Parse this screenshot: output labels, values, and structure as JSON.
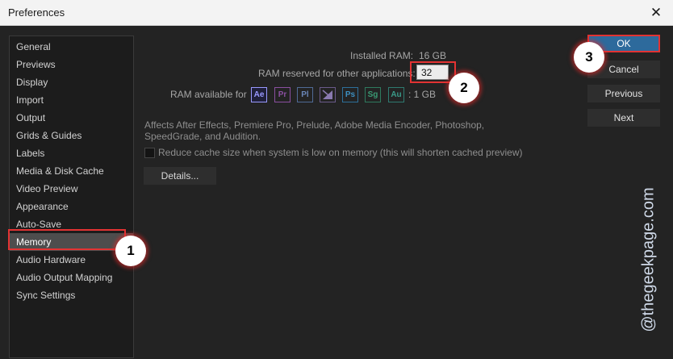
{
  "window": {
    "title": "Preferences",
    "close_glyph": "✕"
  },
  "sidebar": {
    "items": [
      {
        "label": "General"
      },
      {
        "label": "Previews"
      },
      {
        "label": "Display"
      },
      {
        "label": "Import"
      },
      {
        "label": "Output"
      },
      {
        "label": "Grids & Guides"
      },
      {
        "label": "Labels"
      },
      {
        "label": "Media & Disk Cache"
      },
      {
        "label": "Video Preview"
      },
      {
        "label": "Appearance"
      },
      {
        "label": "Auto-Save"
      },
      {
        "label": "Memory"
      },
      {
        "label": "Audio Hardware"
      },
      {
        "label": "Audio Output Mapping"
      },
      {
        "label": "Sync Settings"
      }
    ],
    "selected": "Memory"
  },
  "memory": {
    "installed_ram_label": "Installed RAM:",
    "installed_ram_value": "16 GB",
    "reserved_label": "RAM reserved for other applications:",
    "reserved_value": "32",
    "available_label": "RAM available for",
    "available_value": ": 1 GB",
    "apps": [
      "Ae",
      "Pr",
      "Pl",
      "Me",
      "Ps",
      "Sg",
      "Au"
    ],
    "description": "Affects After Effects, Premiere Pro, Prelude, Adobe Media Encoder, Photoshop, SpeedGrade, and Audition.",
    "checkbox_label": "Reduce cache size when system is low on memory (this will shorten cached preview)",
    "checkbox_checked": false,
    "details_label": "Details..."
  },
  "buttons": {
    "ok": "OK",
    "cancel": "Cancel",
    "previous": "Previous",
    "next": "Next"
  },
  "annotations": {
    "one": "1",
    "two": "2",
    "three": "3"
  },
  "watermark": "@thegeekpage.com",
  "colors": {
    "highlight": "#e23333",
    "ok_blue": "#2d6a9c",
    "selected_bg": "#4d4d4d"
  }
}
